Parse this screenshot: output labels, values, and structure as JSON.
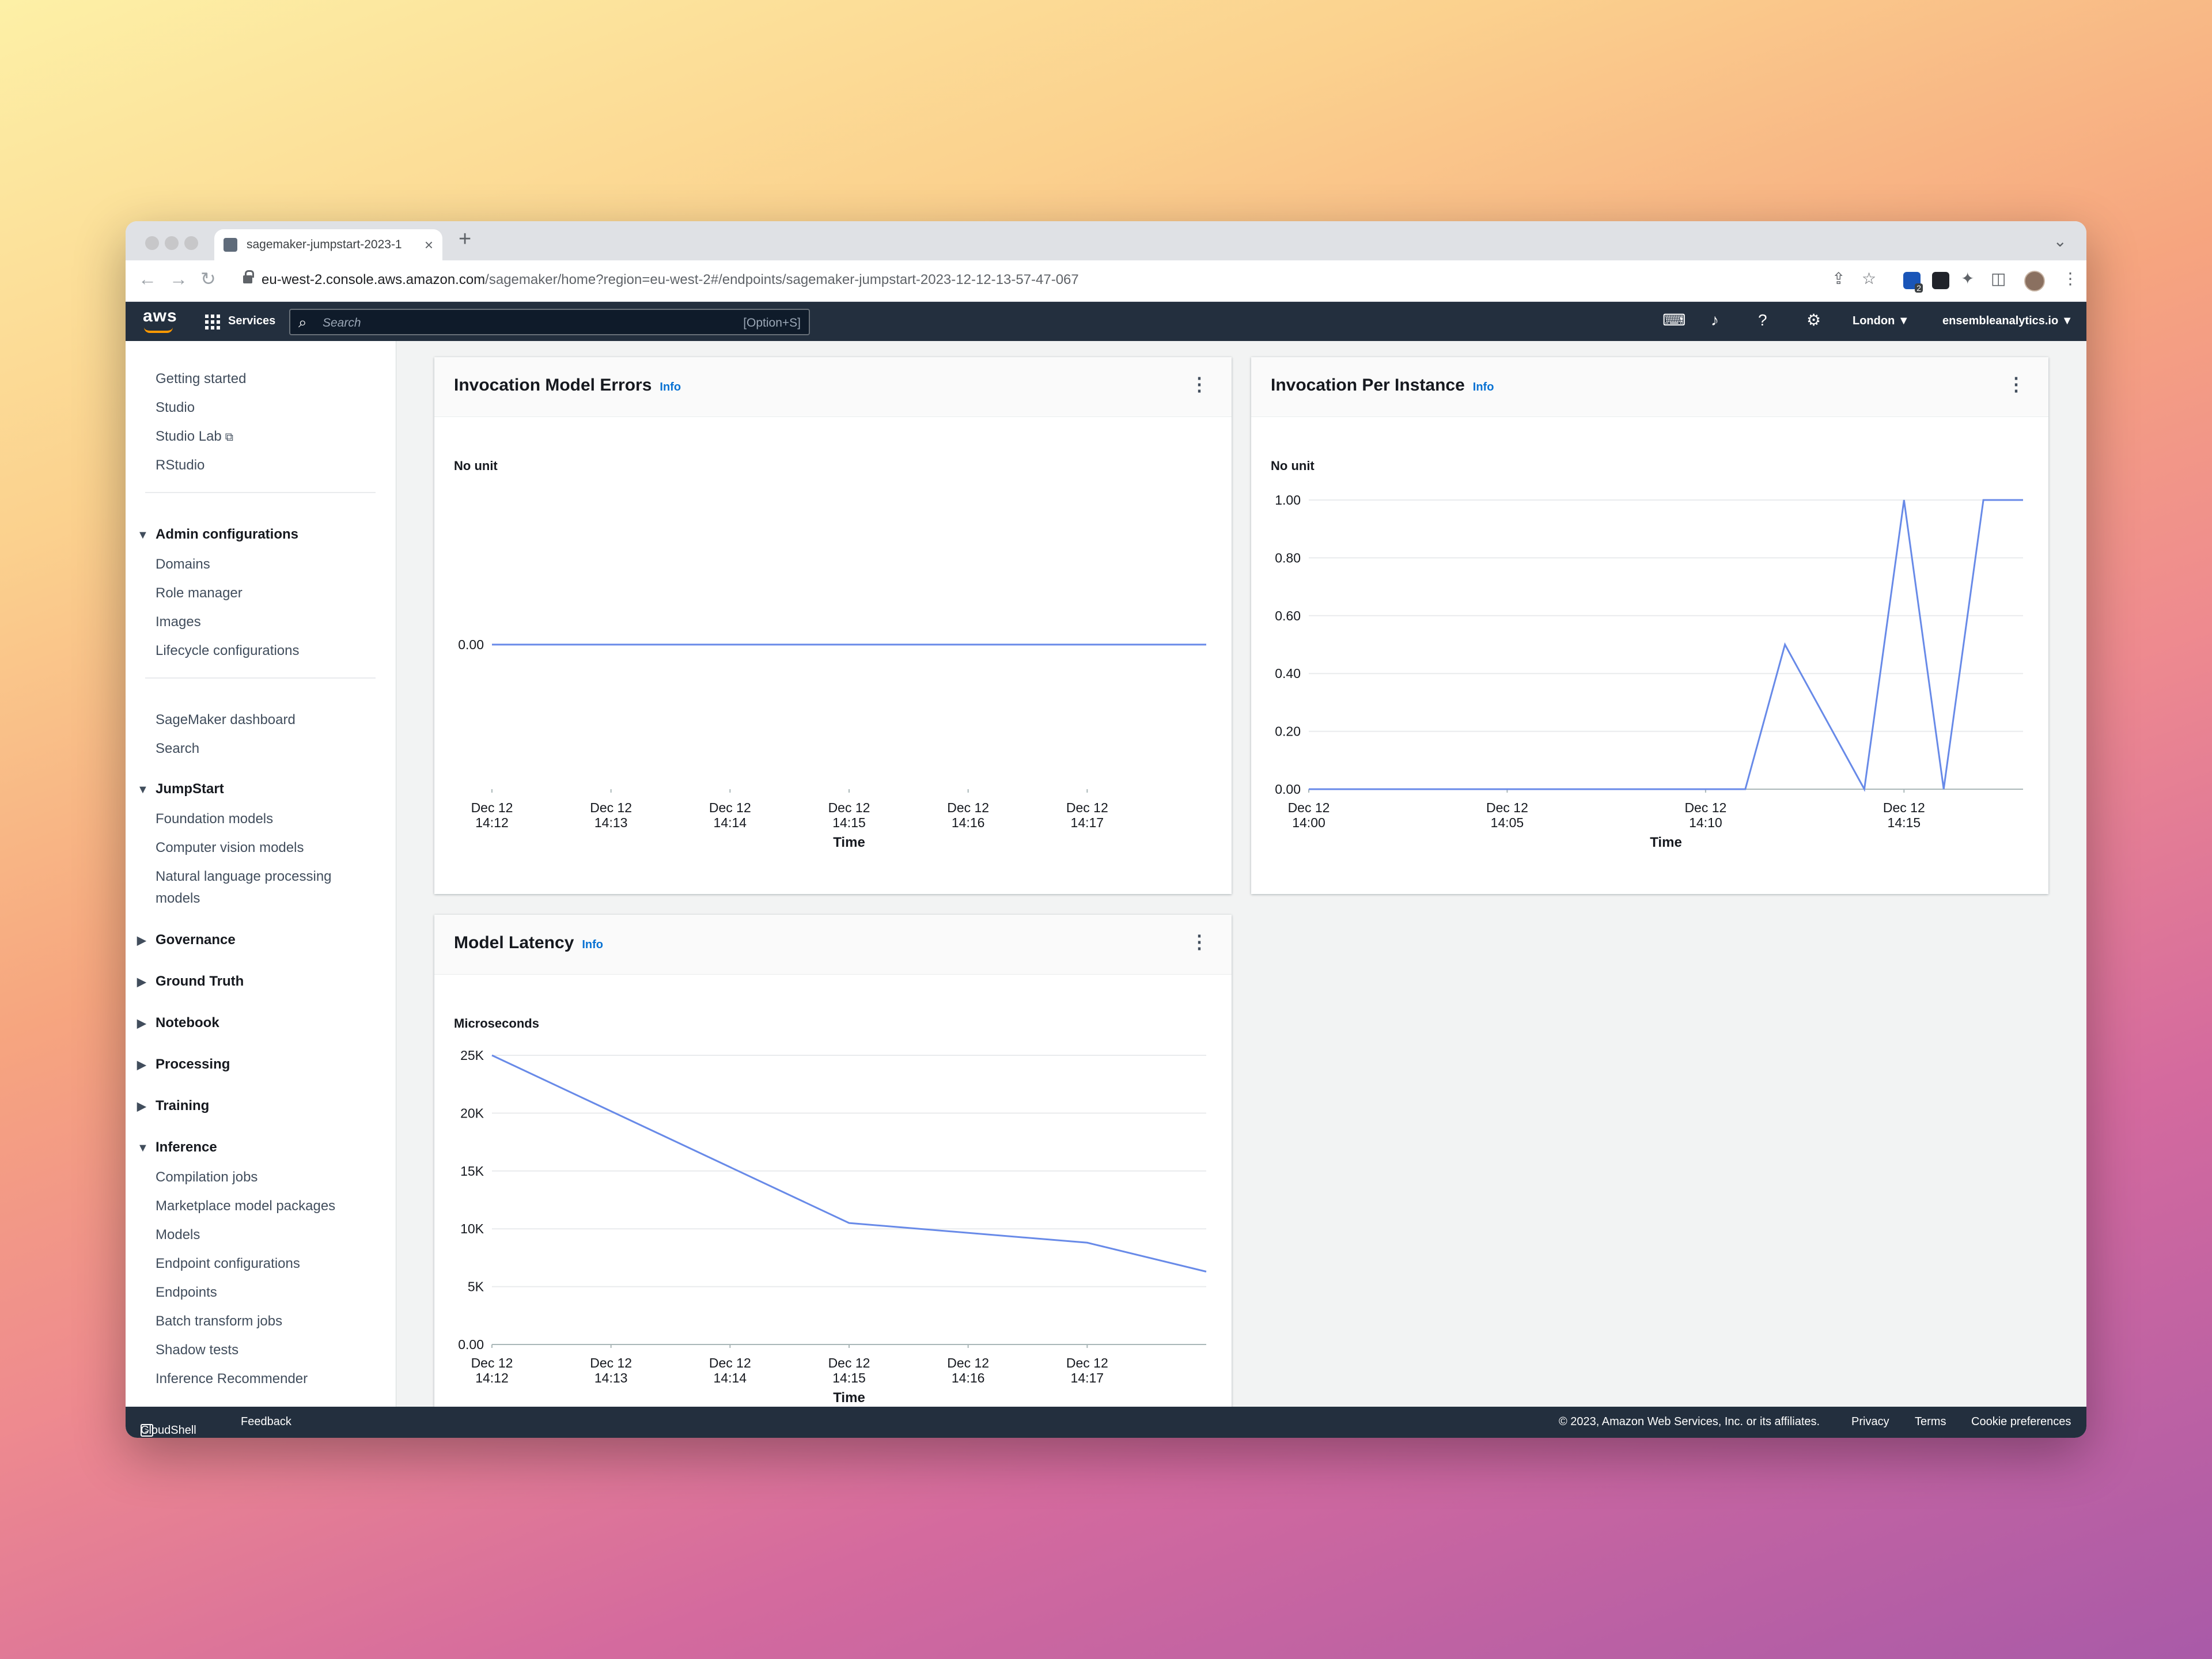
{
  "browser": {
    "tab_title": "sagemaker-jumpstart-2023-1",
    "tab_close": "×",
    "new_tab": "+",
    "url_host": "eu-west-2.console.aws.amazon.com",
    "url_path": "/sagemaker/home?region=eu-west-2#/endpoints/sagemaker-jumpstart-2023-12-12-13-57-47-067",
    "extension_badge": "2"
  },
  "aws_header": {
    "logo": "aws",
    "services_label": "Services",
    "search_placeholder": "Search",
    "search_shortcut": "[Option+S]",
    "region": "London ▼",
    "account": "ensembleanalytics.io ▼"
  },
  "sidebar": {
    "top_items": [
      "Getting started",
      "Studio",
      "Studio Lab",
      "RStudio"
    ],
    "admin": {
      "label": "Admin configurations",
      "items": [
        "Domains",
        "Role manager",
        "Images",
        "Lifecycle configurations"
      ]
    },
    "mid_items": [
      "SageMaker dashboard",
      "Search"
    ],
    "jumpstart": {
      "label": "JumpStart",
      "items": [
        "Foundation models",
        "Computer vision models",
        "Natural language processing",
        "models"
      ]
    },
    "collapsed": [
      "Governance",
      "Ground Truth",
      "Notebook",
      "Processing",
      "Training"
    ],
    "inference": {
      "label": "Inference",
      "items": [
        "Compilation jobs",
        "Marketplace model packages",
        "Models",
        "Endpoint configurations",
        "Endpoints",
        "Batch transform jobs",
        "Shadow tests",
        "Inference Recommender"
      ]
    }
  },
  "panels": {
    "errors": {
      "title": "Invocation Model Errors",
      "info": "Info",
      "menu": "⋮",
      "unit": "No unit"
    },
    "per_instance": {
      "title": "Invocation Per Instance",
      "info": "Info",
      "menu": "⋮",
      "unit": "No unit"
    },
    "latency": {
      "title": "Model Latency",
      "info": "Info",
      "menu": "⋮",
      "unit": "Microseconds"
    }
  },
  "chart_data": [
    {
      "type": "line",
      "title": "Invocation Model Errors",
      "ylabel": "No unit",
      "xlabel": "Time",
      "x_ticks": [
        "Dec 12\n14:12",
        "Dec 12\n14:13",
        "Dec 12\n14:14",
        "Dec 12\n14:15",
        "Dec 12\n14:16",
        "Dec 12\n14:17"
      ],
      "y_ticks": [
        "0.00"
      ],
      "x_range": [
        0,
        6
      ],
      "series": [
        {
          "x": [
            0,
            6
          ],
          "y": [
            0,
            0
          ]
        }
      ],
      "color": "#688ae8"
    },
    {
      "type": "line",
      "title": "Invocation Per Instance",
      "ylabel": "No unit",
      "xlabel": "Time",
      "x_ticks": [
        "Dec 12\n14:00",
        "Dec 12\n14:05",
        "Dec 12\n14:10",
        "Dec 12\n14:15"
      ],
      "x_tick_minutes": [
        0,
        5,
        10,
        15
      ],
      "y_ticks": [
        "0.00",
        "0.20",
        "0.40",
        "0.60",
        "0.80",
        "1.00"
      ],
      "ylim": [
        0,
        1
      ],
      "x_range": [
        0,
        18
      ],
      "series": [
        {
          "x": [
            0,
            11,
            12,
            14,
            15,
            16,
            17,
            18
          ],
          "y": [
            0,
            0,
            0.5,
            0,
            1,
            0,
            1,
            1
          ]
        }
      ],
      "color": "#688ae8"
    },
    {
      "type": "line",
      "title": "Model Latency",
      "ylabel": "Microseconds",
      "xlabel": "Time",
      "x_ticks": [
        "Dec 12\n14:12",
        "Dec 12\n14:13",
        "Dec 12\n14:14",
        "Dec 12\n14:15",
        "Dec 12\n14:16",
        "Dec 12\n14:17"
      ],
      "y_ticks": [
        "0.00",
        "5K",
        "10K",
        "15K",
        "20K",
        "25K"
      ],
      "ylim": [
        0,
        25000
      ],
      "x_range": [
        0,
        6
      ],
      "series": [
        {
          "x": [
            0,
            3,
            5,
            6
          ],
          "y": [
            25000,
            10500,
            8800,
            6300
          ]
        }
      ],
      "color": "#688ae8"
    }
  ],
  "footer": {
    "cloudshell": "CloudShell",
    "feedback": "Feedback",
    "copyright": "© 2023, Amazon Web Services, Inc. or its affiliates.",
    "privacy": "Privacy",
    "terms": "Terms",
    "cookies": "Cookie preferences"
  }
}
